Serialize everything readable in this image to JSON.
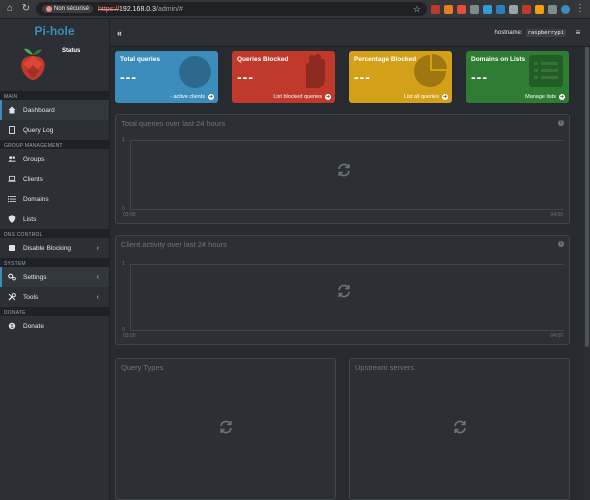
{
  "browser": {
    "insecure_label": "Non sécurisé",
    "url_scheme": "https://",
    "url_host": "192.168.0.3",
    "url_path": "/admin/#"
  },
  "sidebar": {
    "logo": "Pi-hole",
    "status": "Status",
    "sections": {
      "main": "MAIN",
      "group": "GROUP MANAGEMENT",
      "dns": "DNS CONTROL",
      "system": "SYSTEM",
      "donate": "DONATE"
    },
    "items": {
      "dashboard": "Dashboard",
      "query_log": "Query Log",
      "groups": "Groups",
      "clients": "Clients",
      "domains": "Domains",
      "lists": "Lists",
      "disable_blocking": "Disable Blocking",
      "settings": "Settings",
      "tools": "Tools",
      "donate": "Donate"
    }
  },
  "topbar": {
    "toggle": "«",
    "hostname_label": "hostname:",
    "hostname_value": "raspberrypi",
    "menu": "≡"
  },
  "boxes": {
    "total": {
      "title": "Total queries",
      "value": "---",
      "footer": "- active clients",
      "color": "#3c8dbc"
    },
    "blocked": {
      "title": "Queries Blocked",
      "value": "---",
      "footer": "List blocked queries",
      "color": "#c0392b"
    },
    "percent": {
      "title": "Percentage Blocked",
      "value": "---",
      "footer": "List all queries",
      "color": "#d4a017"
    },
    "domains": {
      "title": "Domains on Lists",
      "value": "---",
      "footer": "Manage lists",
      "color": "#2e7d32"
    }
  },
  "panels": {
    "total_queries": {
      "title": "Total queries over last 24 hours",
      "y_top": "1",
      "y_bottom": "0",
      "x_left": "03:00",
      "x_right": "04:00"
    },
    "client_activity": {
      "title": "Client activity over last 24 hours",
      "y_top": "1",
      "y_bottom": "0",
      "x_left": "03:00",
      "x_right": "04:00"
    },
    "query_types": {
      "title": "Query Types"
    },
    "upstream": {
      "title": "Upstream servers"
    }
  }
}
